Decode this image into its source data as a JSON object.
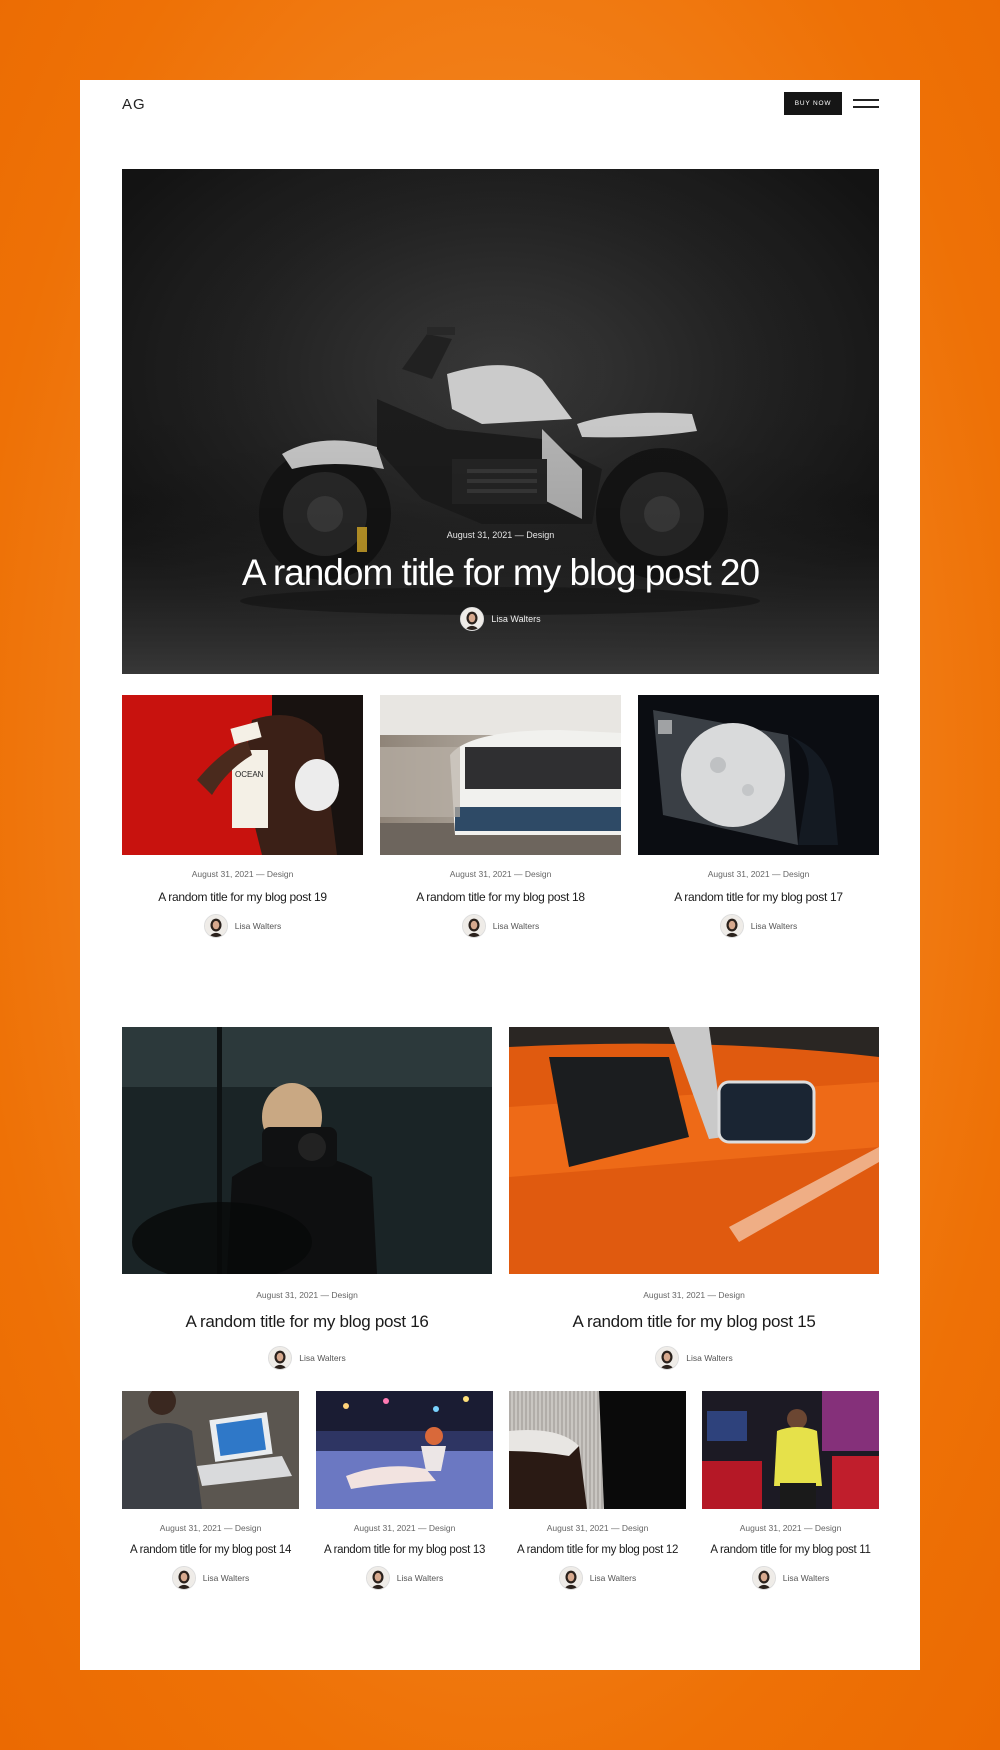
{
  "header": {
    "logo": "AG",
    "buy_label": "BUY NOW"
  },
  "hero": {
    "meta": "August 31, 2021 — Design",
    "title": "A random title for my blog post 20",
    "author": "Lisa Walters"
  },
  "row1": [
    {
      "meta": "August 31, 2021 — Design",
      "title": "A random title for my blog post 19",
      "author": "Lisa Walters"
    },
    {
      "meta": "August 31, 2021 — Design",
      "title": "A random title for my blog post 18",
      "author": "Lisa Walters"
    },
    {
      "meta": "August 31, 2021 — Design",
      "title": "A random title for my blog post 17",
      "author": "Lisa Walters"
    }
  ],
  "row2": [
    {
      "meta": "August 31, 2021 — Design",
      "title": "A random title for my blog post 16",
      "author": "Lisa Walters"
    },
    {
      "meta": "August 31, 2021 — Design",
      "title": "A random title for my blog post 15",
      "author": "Lisa Walters"
    }
  ],
  "row3": [
    {
      "meta": "August 31, 2021 — Design",
      "title": "A random title for my blog post 14",
      "author": "Lisa Walters"
    },
    {
      "meta": "August 31, 2021 — Design",
      "title": "A random title for my blog post 13",
      "author": "Lisa Walters"
    },
    {
      "meta": "August 31, 2021 — Design",
      "title": "A random title for my blog post 12",
      "author": "Lisa Walters"
    },
    {
      "meta": "August 31, 2021 — Design",
      "title": "A random title for my blog post 11",
      "author": "Lisa Walters"
    }
  ],
  "colors": {
    "background": "#ee7106",
    "card": "#ffffff",
    "button": "#151515"
  },
  "icons": {
    "menu": "hamburger-menu-icon",
    "avatar": "author-avatar"
  }
}
